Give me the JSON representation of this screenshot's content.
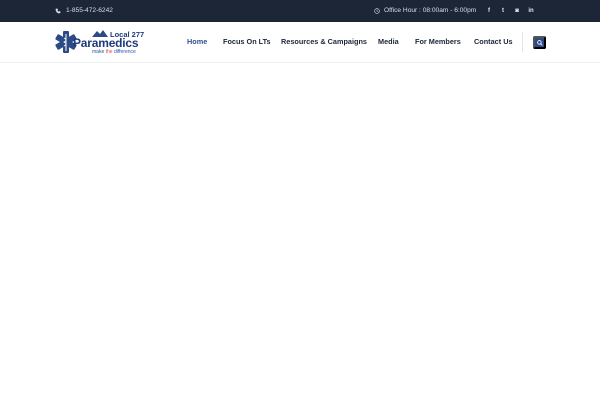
{
  "topbar": {
    "phone": "1-855-472-6242",
    "office_hours": "Office Hour : 08:00am - 6:00pm",
    "social": [
      {
        "icon": "facebook-icon",
        "glyph": "f"
      },
      {
        "icon": "twitter-icon",
        "glyph": "t"
      },
      {
        "icon": "instagram-icon",
        "glyph": "◙"
      },
      {
        "icon": "linkedin-icon",
        "glyph": "in"
      }
    ]
  },
  "logo": {
    "line1": "Local 277",
    "line2": "Paramedics",
    "tagline_part1": "make ",
    "tagline_part2": "the",
    "tagline_part3": " difference"
  },
  "nav": {
    "items": [
      {
        "label": "Home",
        "active": true
      },
      {
        "label": "Focus On LTs",
        "active": false
      },
      {
        "label": "Resources & Campaigns",
        "active": false
      },
      {
        "label": "Media",
        "active": false
      },
      {
        "label": "For Members",
        "active": false
      },
      {
        "label": "Contact Us",
        "active": false
      }
    ]
  },
  "colors": {
    "topbar_bg": "#1d2637",
    "brand_blue": "#2c4a86",
    "text_dark": "#1d2637"
  }
}
